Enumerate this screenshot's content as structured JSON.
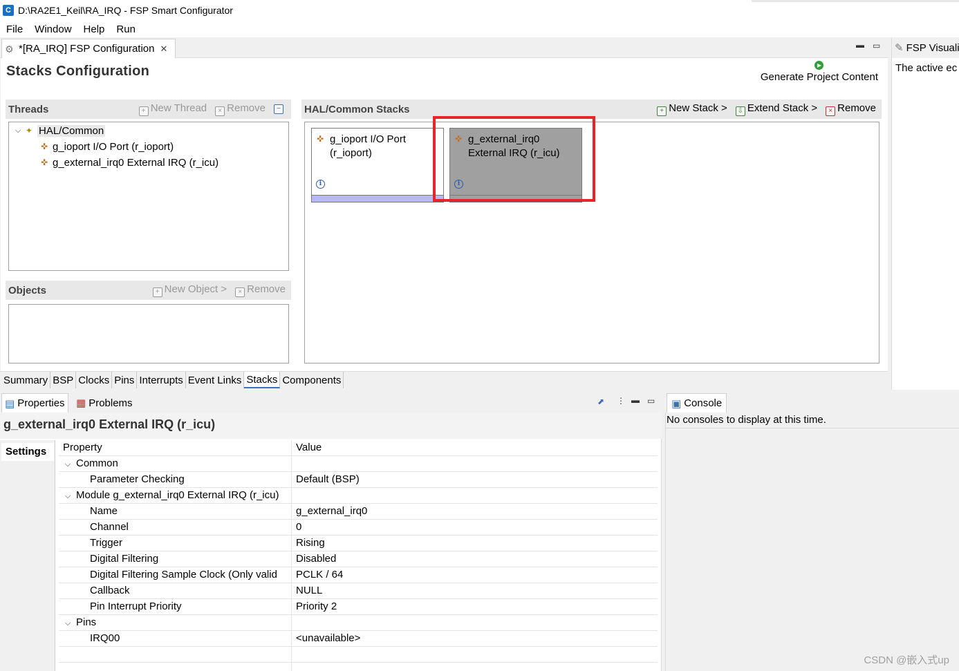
{
  "window": {
    "title": "D:\\RA2E1_Keil\\RA_IRQ - FSP Smart Configurator"
  },
  "menu": [
    "File",
    "Window",
    "Help",
    "Run"
  ],
  "editor": {
    "tab_label": "*[RA_IRQ] FSP Configuration",
    "page_title": "Stacks Configuration",
    "generate_label": "Generate Project Content"
  },
  "threads": {
    "title": "Threads",
    "new_thread": "New Thread",
    "remove": "Remove",
    "tree": {
      "root": "HAL/Common",
      "children": [
        "g_ioport I/O Port (r_ioport)",
        "g_external_irq0 External IRQ (r_icu)"
      ]
    }
  },
  "objects": {
    "title": "Objects",
    "new_object": "New Object >",
    "remove": "Remove"
  },
  "hal_stacks": {
    "title": "HAL/Common Stacks",
    "new_stack": "New Stack >",
    "extend_stack": "Extend Stack >",
    "remove": "Remove",
    "cards": [
      {
        "line1": "g_ioport I/O Port",
        "line2": "(r_ioport)",
        "selected": false
      },
      {
        "line1": "g_external_irq0",
        "line2": "External IRQ (r_icu)",
        "selected": true
      }
    ]
  },
  "bottom_tabs": [
    "Summary",
    "BSP",
    "Clocks",
    "Pins",
    "Interrupts",
    "Event Links",
    "Stacks",
    "Components"
  ],
  "active_bottom_tab": "Stacks",
  "right_view": {
    "tab": "FSP Visuali",
    "body": "The active ec"
  },
  "properties": {
    "tabs": [
      "Properties",
      "Problems"
    ],
    "title": "g_external_irq0 External IRQ (r_icu)",
    "side_tab": "Settings",
    "headers": {
      "property": "Property",
      "value": "Value"
    },
    "rows": [
      {
        "level": 0,
        "expand": true,
        "property": "Common",
        "value": ""
      },
      {
        "level": 1,
        "expand": false,
        "property": "Parameter Checking",
        "value": "Default (BSP)"
      },
      {
        "level": 0,
        "expand": true,
        "property": "Module g_external_irq0 External IRQ (r_icu)",
        "value": ""
      },
      {
        "level": 1,
        "expand": false,
        "property": "Name",
        "value": "g_external_irq0"
      },
      {
        "level": 1,
        "expand": false,
        "property": "Channel",
        "value": "0"
      },
      {
        "level": 1,
        "expand": false,
        "property": "Trigger",
        "value": "Rising"
      },
      {
        "level": 1,
        "expand": false,
        "property": "Digital Filtering",
        "value": "Disabled"
      },
      {
        "level": 1,
        "expand": false,
        "property": "Digital Filtering Sample Clock (Only valid",
        "value": "PCLK / 64"
      },
      {
        "level": 1,
        "expand": false,
        "property": "Callback",
        "value": "NULL"
      },
      {
        "level": 1,
        "expand": false,
        "property": "Pin Interrupt Priority",
        "value": "Priority 2"
      },
      {
        "level": 0,
        "expand": true,
        "property": "Pins",
        "value": ""
      },
      {
        "level": 1,
        "expand": false,
        "property": "IRQ00",
        "value": "<unavailable>"
      }
    ]
  },
  "console": {
    "tab": "Console",
    "message": "No consoles to display at this time."
  },
  "watermark": "CSDN @嵌入式up",
  "colors": {
    "highlight": "#e8232a",
    "selected_card": "#a0a0a0",
    "card_bar": "#b8b8ff"
  }
}
